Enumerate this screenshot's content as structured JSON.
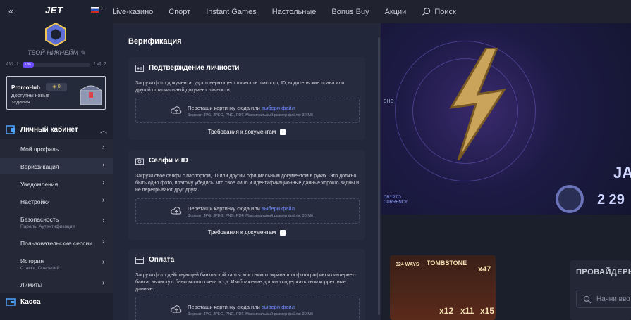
{
  "topnav": {
    "items": [
      "Live-казино",
      "Спорт",
      "Instant Games",
      "Настольные",
      "Bonus Buy",
      "Акции"
    ],
    "search_label": "Поиск"
  },
  "sidebar": {
    "logo": "JET",
    "nickname": "ТВОЙ НИКНЕЙМ",
    "level_from": "LVL 1",
    "level_to": "LVL 2",
    "progress_label": "0%",
    "progress": 0,
    "promo": {
      "name": "PromoHub",
      "badge": "0",
      "desc": "Доступны новые задания"
    },
    "section": "Личный кабинет",
    "items": [
      {
        "label": "Мой профиль",
        "hint": ""
      },
      {
        "label": "Верификация",
        "hint": ""
      },
      {
        "label": "Уведомления",
        "hint": ""
      },
      {
        "label": "Настройки",
        "hint": ""
      },
      {
        "label": "Безопасность",
        "hint": "Пароль, Аутентификация"
      },
      {
        "label": "Пользовательские сессии",
        "hint": ""
      },
      {
        "label": "История",
        "hint": "Ставки, Операций"
      },
      {
        "label": "Лимиты",
        "hint": ""
      }
    ],
    "kassa": "Касса"
  },
  "panel": {
    "title": "Верификация",
    "cards": [
      {
        "title": "Подтверждение личности",
        "text": "Загрузи фото документа, удостоверяющего личность: паспорт, ID, водительские права или другой официальный документ личности.",
        "drop_text": "Перетащи картинку сюда или ",
        "drop_link": "выбери файл",
        "drop_hint": "Формат: JPG, JPEG, PNG, PDF. Максимальный размер файла: 30 Мб",
        "requirements": "Требования к документам"
      },
      {
        "title": "Селфи и ID",
        "text": "Загрузи свое селфи с паспортом, ID или другим официальным документом в руках. Это должно быть одно фото, поэтому убедись, что твое лицо и идентификационные данные хорошо видны и не перекрывают друг друга.",
        "drop_text": "Перетащи картинку сюда или ",
        "drop_link": "выбери файл",
        "drop_hint": "Формат: JPG, JPEG, PNG, PDF. Максимальный размер файла: 30 Мб",
        "requirements": "Требования к документам"
      },
      {
        "title": "Оплата",
        "text": "Загрузи фото действующей банковской карты или снимок экрана или фотографию из интернет-банка, выписку с банковского счета и т.д. Изображение должно содержать твои корректные данные.",
        "drop_text": "Перетащи картинку сюда или ",
        "drop_link": "выбери файл",
        "drop_hint": "Формат: JPG, JPEG, PNG, PDF. Максимальный размер файла: 30 Мб"
      }
    ]
  },
  "background": {
    "side_label": "эно",
    "banner_text": "JA",
    "banner_amount": "2 29",
    "crypto_tag": "CRYPTO CURRENCY",
    "slot_title": "TOMBSTONE",
    "slot_ways": "324 WAYS",
    "slot_mult1": "x47",
    "slot_mult2": "x12",
    "slot_mult3": "x11",
    "slot_mult4": "x15",
    "providers_title": "ПРОВАЙДЕРЫ",
    "providers_search": "Начни вво"
  }
}
